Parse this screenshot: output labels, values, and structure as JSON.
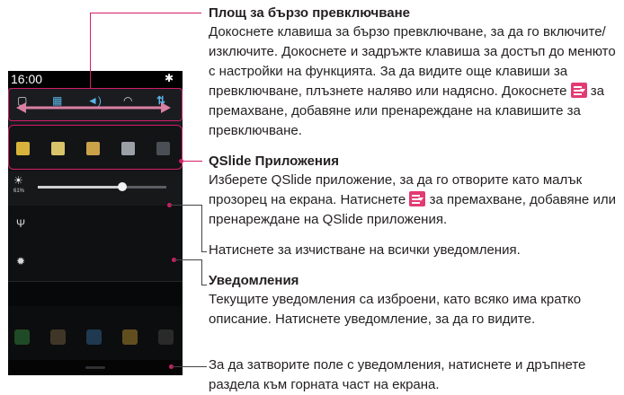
{
  "phone": {
    "time": "16:00",
    "settings_icon": "gear-icon",
    "quick_settings": [
      "rotate-icon",
      "grid-icon",
      "volume-icon",
      "wifi-icon",
      "data-icon"
    ],
    "qslide_apps": [
      "memo-icon",
      "pencil-icon",
      "folder-icon",
      "calculator-icon",
      "edit-list-icon"
    ],
    "brightness": {
      "percent_label": "61%",
      "level": 0.66
    },
    "notifications": [
      "usb-icon",
      "android-icon"
    ],
    "colors": {
      "accent": "#d31e68",
      "qslide_icon_bg": "#e23b74"
    }
  },
  "annotations": {
    "quick_switch": {
      "heading": "Площ за бързо превключване",
      "text_before": "Докоснете клавиша за бързо превключване, за да го включите/изключите. Докоснете и задръжте клавиша за достъп до менюто с настройки на функцията. За да видите още клавиши за превключване, плъзнете наляво или надясно. Докоснете",
      "text_after": "за премахване, добавяне или пренареждане на клавишите за превключване."
    },
    "qslide": {
      "heading": "QSlide Приложения",
      "text_before": "Изберете QSlide приложение, за да го отворите като малък прозорец на екрана. Натиснете",
      "text_after": "за премахване, добавяне или пренареждане на QSlide приложения."
    },
    "clear": {
      "text": "Натиснете за изчистване на всички уведомления."
    },
    "notifications": {
      "heading": "Уведомления",
      "text": "Текущите уведомления са изброени, като всяко има кратко описание. Натиснете уведомление, за да го видите."
    },
    "close": {
      "text": "За да затворите поле с уведомления, натиснете и дръпнете раздела към горната част на екрана."
    }
  }
}
